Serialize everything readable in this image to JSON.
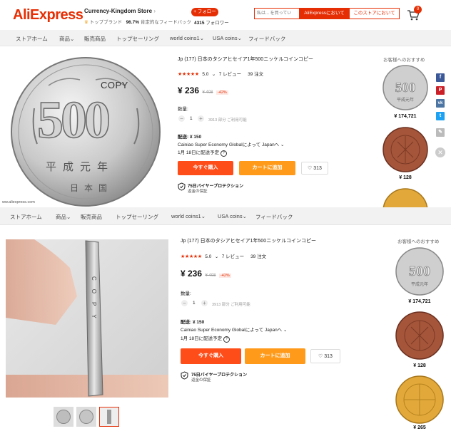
{
  "header": {
    "logo": "AliExpress",
    "store_name": "Currency-Kingdom Store",
    "store_badge": "トップブランド",
    "store_rating": "96.7%",
    "store_rating_label": "肯定的なフィードバック",
    "follow_label": "+ フォロー",
    "followers_count": "4315",
    "followers_label": "フォロワー",
    "search_placeholder": "私は... を買ってい",
    "search_aliexpress": "AliExpressにおいて",
    "search_store": "このストアにおいて",
    "cart_count": "0"
  },
  "nav1": [
    "ストアホーム",
    "商品",
    "販売商品",
    "トップセーリング",
    "world coins1",
    "USA coins",
    "フィードバック"
  ],
  "nav2": [
    "ストアホーム",
    "商品",
    "販売商品",
    "トップセーリング",
    "world coins1",
    "USA coins",
    "フィードバック"
  ],
  "product": {
    "title": "Jp (177) 日本のタシアヒセイア1年500ニッケルコインコピー",
    "stars": "★★★★★",
    "rating": "5.0",
    "reviews": "7 レビュー",
    "orders": "39 注文",
    "price": "¥ 236",
    "old_price": "¥ 408",
    "discount": "-42%",
    "qty_label": "数量:",
    "qty_value": "1",
    "stock": "3913 部分 ご利用可能",
    "shipping_label": "配送: ¥ 150",
    "shipping_method": "Cainiao Super Economy Globalによって Japanへ",
    "delivery_date": "1月 18日に配送予定",
    "buy_now": "今すぐ購入",
    "add_to_cart": "カートに追加",
    "wishlist_count": "313",
    "protection_title": "75日バイヤープロテクション",
    "protection_sub": "返金の保証"
  },
  "recommend": {
    "title": "お客様へのおすすめ",
    "items": [
      {
        "price": "¥ 174,721"
      },
      {
        "price": "¥ 128"
      },
      {
        "price": "¥ 265"
      }
    ]
  },
  "coin": {
    "copy_text": "COPY",
    "value": "500",
    "era_text": "平成元年",
    "country_text": "日本国"
  },
  "watermark": "ww.aliexpress.com",
  "edge_text": "COPY",
  "colors": {
    "brand": "#e62e04",
    "buy": "#ff4d1a",
    "cart": "#ff9a1a",
    "facebook": "#3b5998",
    "pinterest": "#cb2027",
    "vk": "#4c75a3",
    "twitter": "#1da1f2"
  }
}
